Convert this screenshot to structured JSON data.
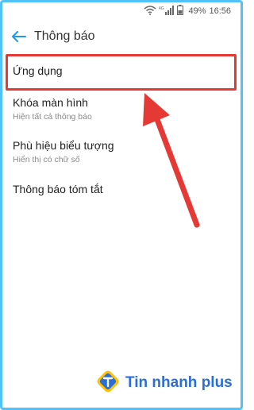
{
  "status_bar": {
    "battery_percent": "49%",
    "time": "16:56",
    "icons": [
      "wifi-icon",
      "4g-signal-icon",
      "battery-icon"
    ]
  },
  "header": {
    "title": "Thông báo"
  },
  "settings": {
    "items": [
      {
        "label": "Ứng dụng",
        "sub": ""
      },
      {
        "label": "Khóa màn hình",
        "sub": "Hiện tất cả thông báo"
      },
      {
        "label": "Phù hiệu biểu tượng",
        "sub": "Hiển thị có chữ số"
      },
      {
        "label": "Thông báo tóm tắt",
        "sub": ""
      }
    ]
  },
  "watermark": {
    "text": "Tin nhanh plus"
  },
  "colors": {
    "accent": "#2196f3",
    "highlight": "#e53935",
    "frame": "#4fc3f7",
    "brand": "#2a6fd6"
  }
}
